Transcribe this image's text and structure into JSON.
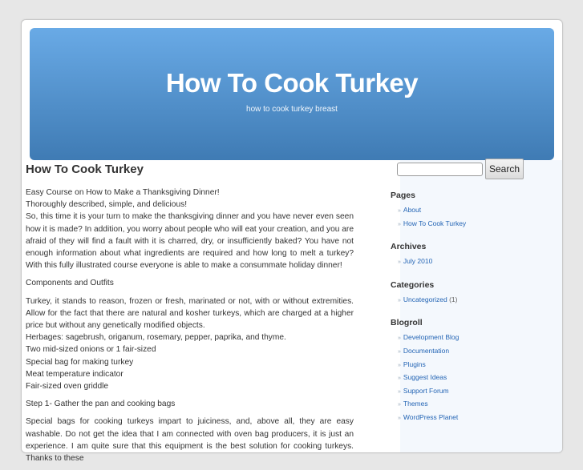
{
  "header": {
    "title": "How To Cook Turkey",
    "description": "how to cook turkey breast"
  },
  "post": {
    "title": "How To Cook Turkey",
    "paragraphs": [
      {
        "lines": [
          "Easy Course on How to Make a Thanksgiving Dinner!",
          "Thoroughly described, simple, and delicious!"
        ],
        "body": "So, this time it is your turn to make the thanksgiving dinner and you have never even seen how it is made? In addition, you worry about people who will eat your creation, and you are afraid of they will find a fault with it is charred, dry, or insufficiently baked? You have not enough information about what ingredients are required and how long to melt a turkey? With this fully illustrated course everyone is able to make a consummate holiday dinner!"
      }
    ],
    "section1_heading": "Components and Outfits",
    "ingredients_intro": "Turkey, it stands to reason, frozen or fresh, marinated or not, with or without extremities. Allow for the fact that there are natural and kosher turkeys, which are charged at a higher price but without any genetically modified objects.",
    "ingredients": [
      "Herbages: sagebrush, origanum, rosemary, pepper, paprika, and thyme.",
      "Two mid-sized onions or 1 fair-sized",
      "Special bag for making turkey",
      "Meat temperature indicator",
      "Fair-sized oven griddle"
    ],
    "step1_heading": "Step 1- Gather the pan and cooking bags",
    "step1_body": "Special bags for cooking turkeys impart to juiciness, and, above all, they are easy washable. Do not get the idea that I am connected with oven bag producers, it is just an experience. I am quite sure that this equipment is the best solution for cooking turkeys. Thanks to these"
  },
  "sidebar": {
    "search": {
      "value": "",
      "button_label": "Search"
    },
    "pages": {
      "title": "Pages",
      "items": [
        "About",
        "How To Cook Turkey"
      ]
    },
    "archives": {
      "title": "Archives",
      "items": [
        "July 2010"
      ]
    },
    "categories": {
      "title": "Categories",
      "items": [
        {
          "label": "Uncategorized",
          "count": "(1)"
        }
      ]
    },
    "blogroll": {
      "title": "Blogroll",
      "items": [
        "Development Blog",
        "Documentation",
        "Plugins",
        "Suggest Ideas",
        "Support Forum",
        "Themes",
        "WordPress Planet"
      ]
    },
    "bullet": "»"
  },
  "colors": {
    "header_top": "#69aae6",
    "header_bottom": "#3f7bb4",
    "link": "#2465b5",
    "sidebar_bg": "#f4f8fd",
    "page_bg": "#e7e7e7"
  }
}
